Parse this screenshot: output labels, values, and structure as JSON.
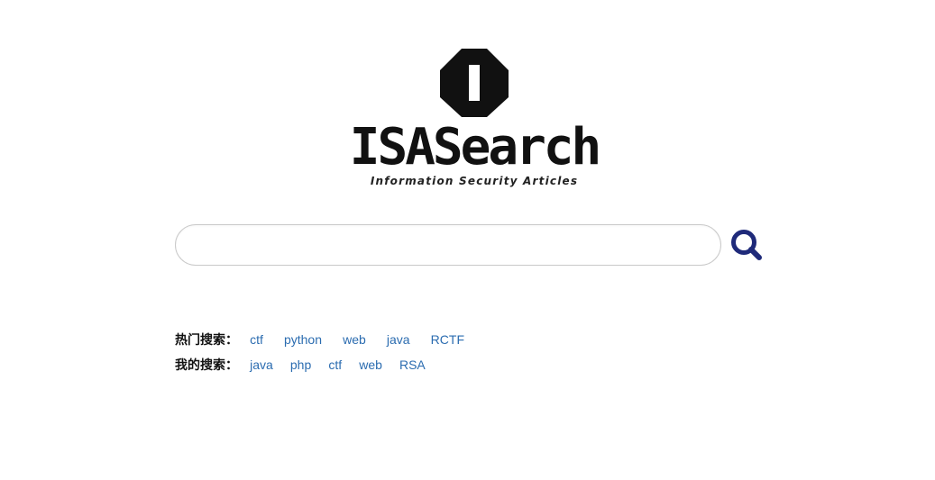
{
  "logo": {
    "emblem_icon": "octagon-emblem-icon",
    "title": "ISASearch",
    "subtitle": "Information Security Articles"
  },
  "search": {
    "value": "",
    "placeholder": "",
    "button_icon": "search-icon",
    "accent_color": "#1f2a7a"
  },
  "hot_searches": {
    "label": "热门搜索：",
    "items": [
      "ctf",
      "python",
      "web",
      "java",
      "RCTF"
    ]
  },
  "my_searches": {
    "label": "我的搜索：",
    "items": [
      "java",
      "php",
      "ctf",
      "web",
      "RSA"
    ]
  },
  "colors": {
    "link": "#2b6cb0",
    "label": "#111111"
  }
}
